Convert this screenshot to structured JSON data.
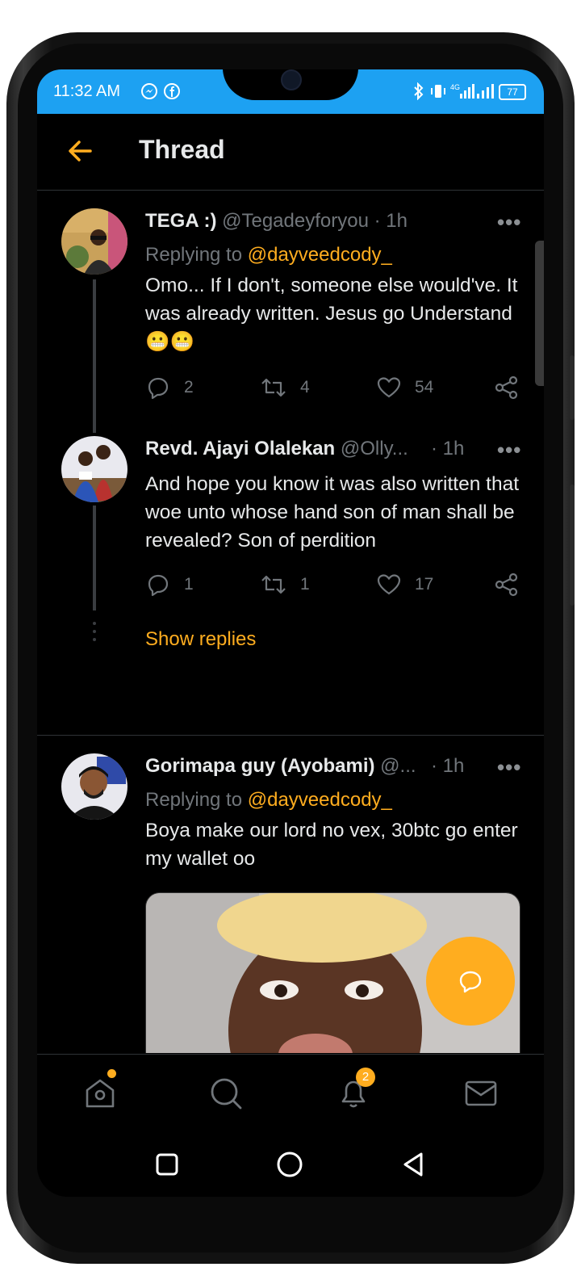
{
  "status": {
    "time": "11:32 AM",
    "battery": "77",
    "network": "4G"
  },
  "header": {
    "title": "Thread"
  },
  "tweets": [
    {
      "name": "TEGA :)",
      "handle": "@Tegadeyforyou",
      "time": "· 1h",
      "replying_prefix": "Replying to",
      "replying_to": "@dayveedcody_",
      "text": "Omo... If I don't, someone else would've. It was already written.  Jesus go Understand 😬😬",
      "replies": "2",
      "retweets": "4",
      "likes": "54"
    },
    {
      "name": "Revd. Ajayi Olalekan",
      "handle": "@Olly...",
      "time": "· 1h",
      "text": "And hope you know it was also written that woe unto whose hand son of man shall be revealed? Son of perdition",
      "replies": "1",
      "retweets": "1",
      "likes": "17"
    },
    {
      "name": "Gorimapa guy (Ayobami)",
      "handle": "@...",
      "time": "· 1h",
      "replying_prefix": "Replying to",
      "replying_to": "@dayveedcody_",
      "text": "Boya make our lord no vex, 30btc go enter my wallet oo"
    }
  ],
  "show_replies": "Show replies",
  "nav": {
    "notifications_badge": "2"
  },
  "colors": {
    "accent": "#ffad1f",
    "statusbar": "#1da1f2",
    "background": "#000000"
  }
}
